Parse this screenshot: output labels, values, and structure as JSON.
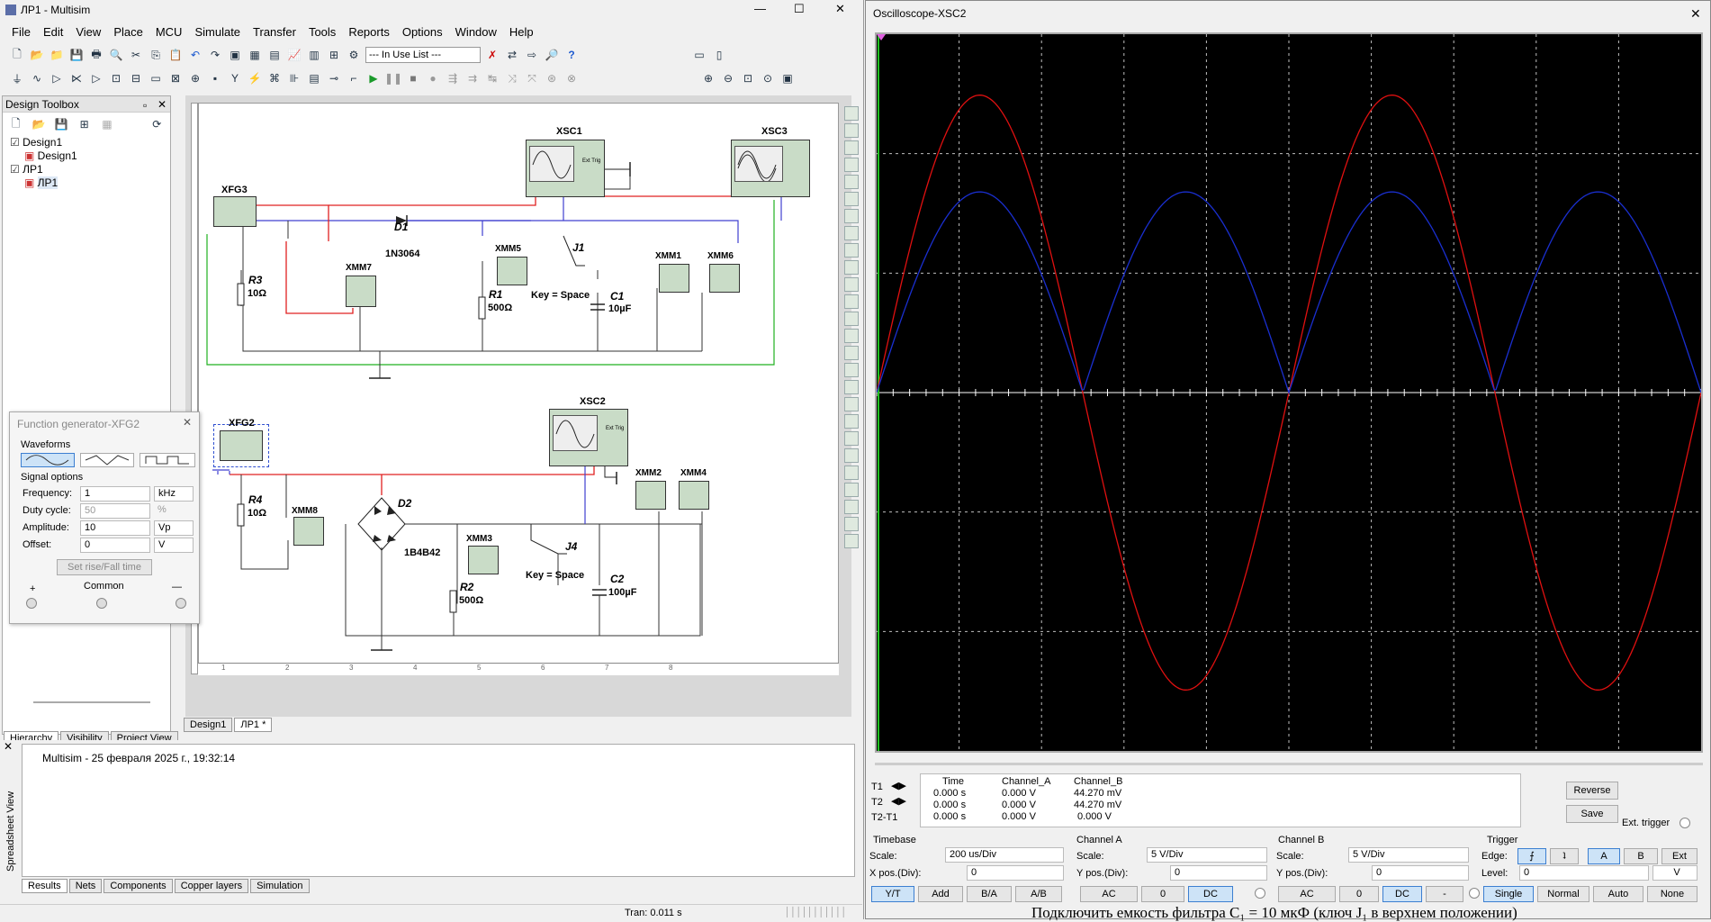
{
  "main_window": {
    "title": "ЛР1 - Multisim",
    "title_controls": [
      "—",
      "☐",
      "✕"
    ]
  },
  "menu": [
    "File",
    "Edit",
    "View",
    "Place",
    "MCU",
    "Simulate",
    "Transfer",
    "Tools",
    "Reports",
    "Options",
    "Window",
    "Help"
  ],
  "toolbar": {
    "in_use_list": "--- In Use List ---"
  },
  "design_toolbox": {
    "title": "Design Toolbox",
    "tree": [
      {
        "label": "Design1",
        "level": 0
      },
      {
        "label": "Design1",
        "level": 1
      },
      {
        "label": "ЛР1",
        "level": 0
      },
      {
        "label": "ЛР1",
        "level": 1
      }
    ],
    "tabs": [
      "Hierarchy",
      "Visibility",
      "Project View"
    ]
  },
  "schematic": {
    "ruler": [
      "1",
      "2",
      "3",
      "4",
      "5",
      "6",
      "7",
      "8"
    ],
    "labels": {
      "xsc1": "XSC1",
      "xsc3": "XSC3",
      "xsc2": "XSC2",
      "xfg3": "XFG3",
      "xfg2": "XFG2",
      "d1": "D1",
      "d1_model": "1N3064",
      "d2": "D2",
      "d2_model": "1B4B42",
      "j1": "J1",
      "j4": "J4",
      "key1": "Key = Space",
      "key4": "Key = Space",
      "r1": "R1",
      "r1_val": "500Ω",
      "r2": "R2",
      "r2_val": "500Ω",
      "r3": "R3",
      "r3_val": "10Ω",
      "r4": "R4",
      "r4_val": "10Ω",
      "c1": "C1",
      "c1_val": "10µF",
      "c2": "C2",
      "c2_val": "100µF",
      "xmm1": "XMM1",
      "xmm2": "XMM2",
      "xmm3": "XMM3",
      "xmm4": "XMM4",
      "xmm5": "XMM5",
      "xmm6": "XMM6",
      "xmm7": "XMM7",
      "xmm8": "XMM8",
      "ext_trig": "Ext Trig"
    }
  },
  "sheet_tabs": [
    "Design1",
    "ЛР1 *"
  ],
  "function_generator": {
    "title": "Function generator-XFG2",
    "waveforms_label": "Waveforms",
    "signal_options_label": "Signal options",
    "frequency": {
      "label": "Frequency:",
      "value": "1",
      "unit": "kHz"
    },
    "duty": {
      "label": "Duty cycle:",
      "value": "50",
      "unit": "%"
    },
    "amplitude": {
      "label": "Amplitude:",
      "value": "10",
      "unit": "Vp"
    },
    "offset": {
      "label": "Offset:",
      "value": "0",
      "unit": "V"
    },
    "rise_fall": "Set rise/Fall time",
    "plus": "+",
    "common": "Common",
    "minus": "—"
  },
  "spreadsheet": {
    "side_label": "Spreadsheet View",
    "message": "Multisim  -  25 февраля 2025 г., 19:32:14",
    "tabs": [
      "Results",
      "Nets",
      "Components",
      "Copper layers",
      "Simulation"
    ]
  },
  "status": {
    "tran": "Tran: 0.011 s"
  },
  "oscilloscope": {
    "title": "Oscilloscope-XSC2",
    "close": "✕",
    "readout": {
      "headers": [
        "Time",
        "Channel_A",
        "Channel_B"
      ],
      "rows": [
        {
          "name": "T1",
          "time": "0.000 s",
          "a": "0.000 V",
          "b": "44.270 mV"
        },
        {
          "name": "T2",
          "time": "0.000 s",
          "a": "0.000 V",
          "b": "44.270 mV"
        },
        {
          "name": "T2-T1",
          "time": "0.000 s",
          "a": "0.000 V",
          "b": "0.000 V"
        }
      ]
    },
    "reverse": "Reverse",
    "save": "Save",
    "ext_trigger": "Ext. trigger",
    "timebase": {
      "title": "Timebase",
      "scale_label": "Scale:",
      "scale": "200 us/Div",
      "xpos_label": "X pos.(Div):",
      "xpos": "0",
      "modes": [
        "Y/T",
        "Add",
        "B/A",
        "A/B"
      ]
    },
    "channel_a": {
      "title": "Channel A",
      "scale_label": "Scale:",
      "scale": "5  V/Div",
      "ypos_label": "Y pos.(Div):",
      "ypos": "0",
      "coupling": [
        "AC",
        "0",
        "DC"
      ]
    },
    "channel_b": {
      "title": "Channel B",
      "scale_label": "Scale:",
      "scale": "5  V/Div",
      "ypos_label": "Y pos.(Div):",
      "ypos": "0",
      "coupling": [
        "AC",
        "0",
        "DC",
        "-"
      ]
    },
    "trigger": {
      "title": "Trigger",
      "edge_label": "Edge:",
      "edge_buttons": [
        "⨍",
        "ʇ",
        "A",
        "B",
        "Ext"
      ],
      "level_label": "Level:",
      "level": "0",
      "level_unit": "V",
      "modes": [
        "Single",
        "Normal",
        "Auto",
        "None"
      ]
    },
    "colors": {
      "channel_a": "#e01010",
      "channel_b": "#1a2fd0",
      "screen": "#000000",
      "grid": "#bfbfbf"
    }
  },
  "footer_text": "Подключить емкость фильтра C₁ = 10 мкФ (ключ J₁ в верхнем положении)"
}
